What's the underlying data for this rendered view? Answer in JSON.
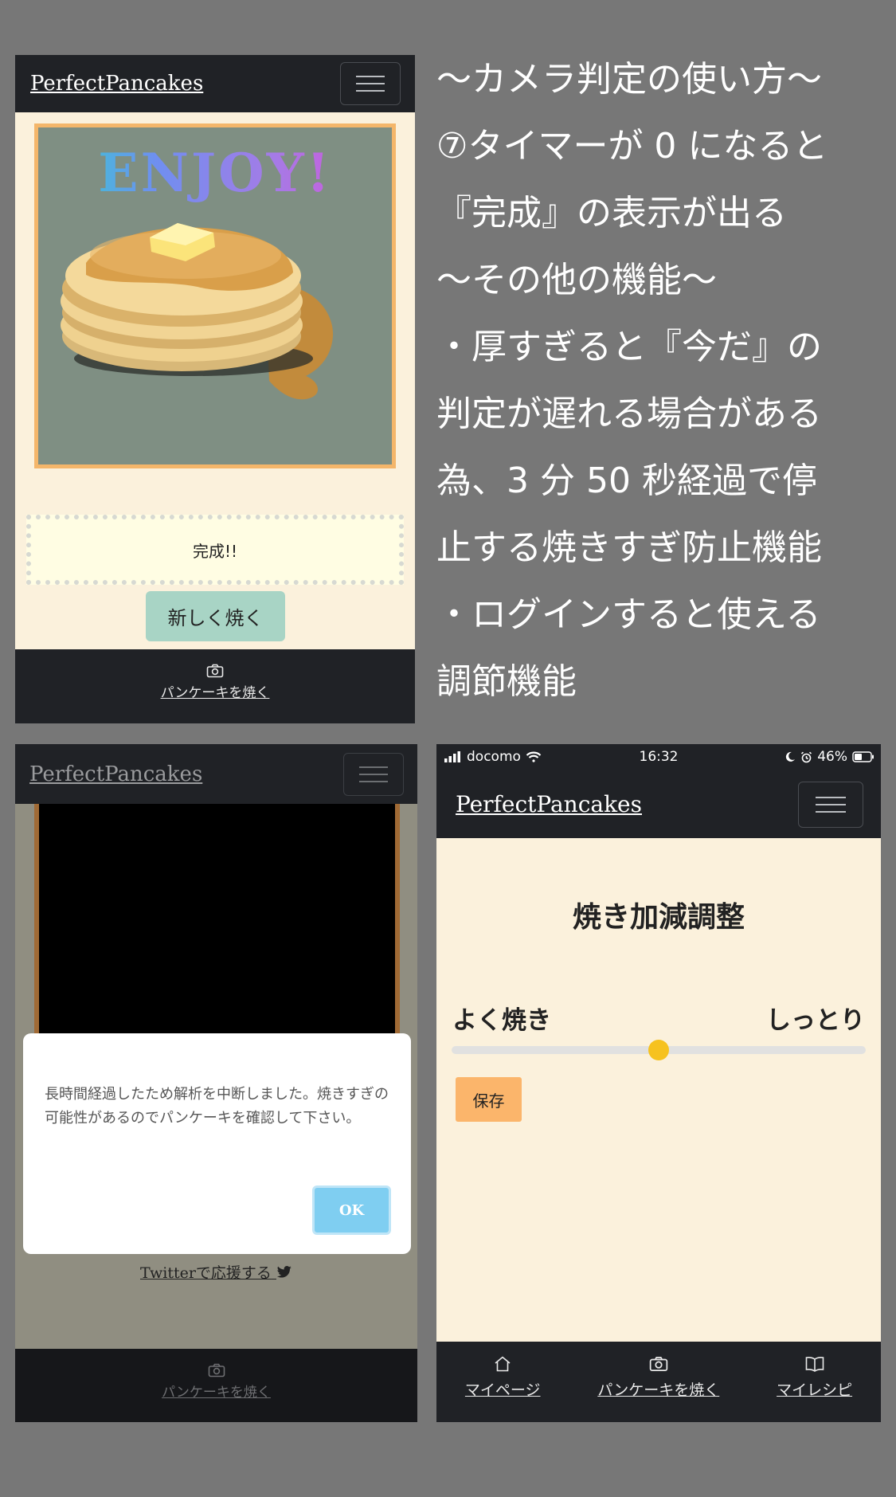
{
  "screen1": {
    "brand": "PerfectPancakes",
    "enjoy_text": "ENJOY!",
    "status_text": "完成!!",
    "new_button": "新しく焼く",
    "footer_link": "パンケーキを焼く",
    "icons": [
      "menu-icon",
      "camera-icon"
    ]
  },
  "caption": {
    "lines": [
      "〜カメラ判定の使い方〜",
      " ⑦タイマーが 0 になると",
      "『完成』の表示が出る",
      "〜その他の機能〜",
      "・厚すぎると『今だ』の",
      "判定が遅れる場合がある",
      "為、3 分 50 秒経過で停",
      "止する焼きすぎ防止機能",
      "・ログインすると使える",
      "調節機能"
    ]
  },
  "screen2": {
    "brand": "PerfectPancakes",
    "dialog_message": "長時間経過したため解析を中断しました。焼きすぎの可能性があるのでパンケーキを確認して下さい。",
    "ok_button": "OK",
    "twitter_link": "Twitterで応援する",
    "footer_link": "パンケーキを焼く",
    "icons": [
      "menu-icon",
      "twitter-icon",
      "camera-icon"
    ]
  },
  "screen3": {
    "status_bar": {
      "carrier": "docomo",
      "time": "16:32",
      "battery": "46%",
      "icons": [
        "signal-icon",
        "wifi-icon",
        "moon-icon",
        "alarm-icon",
        "battery-icon"
      ]
    },
    "brand": "PerfectPancakes",
    "title": "焼き加減調整",
    "label_left": "よく焼き",
    "label_right": "しっとり",
    "slider_value": 0.5,
    "save_button": "保存",
    "footer_items": [
      {
        "label": "マイページ",
        "icon": "home-icon"
      },
      {
        "label": "パンケーキを焼く",
        "icon": "camera-icon"
      },
      {
        "label": "マイレシピ",
        "icon": "book-icon"
      }
    ]
  },
  "colors": {
    "background": "#777777",
    "navbar": "#202226",
    "cream": "#fbf1dc",
    "new_button": "#a8d4c5",
    "ok_button": "#7fcef1",
    "save_button": "#fbb56b",
    "slider_thumb": "#f6c21f",
    "photo_border": "#f4b66a"
  }
}
